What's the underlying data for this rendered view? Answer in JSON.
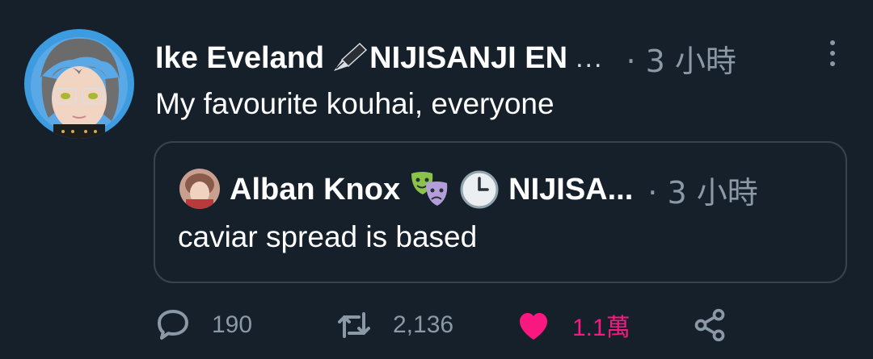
{
  "tweet": {
    "author_name": "Ike Eveland",
    "author_name_suffix": "NIJISANJI EN",
    "truncation": "...",
    "meta": "· 3 小時",
    "text": "My favourite kouhai, everyone"
  },
  "quoted": {
    "author_name": "Alban Knox",
    "author_name_suffix": "NIJISA...",
    "meta": "· 3 小時",
    "text": "caviar spread is based"
  },
  "actions": {
    "reply_count": "190",
    "retweet_count": "2,136",
    "like_count": "1.1萬"
  },
  "colors": {
    "background": "#15202b",
    "secondary_text": "#8b98a5",
    "like": "#f91880",
    "border": "#38444d"
  },
  "icons": [
    "reply-icon",
    "retweet-icon",
    "like-icon",
    "share-icon",
    "more-icon",
    "fountain-pen-icon",
    "performing-arts-icon",
    "clock-icon"
  ]
}
